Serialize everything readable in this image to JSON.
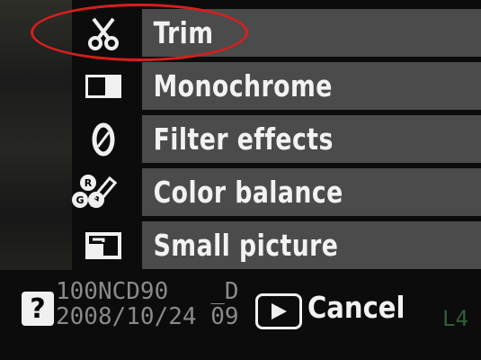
{
  "menu": {
    "items": [
      {
        "label": "Trim",
        "icon": "scissors-icon"
      },
      {
        "label": "Monochrome",
        "icon": "monochrome-icon"
      },
      {
        "label": "Filter effects",
        "icon": "filter-lens-icon"
      },
      {
        "label": "Color balance",
        "icon": "color-balance-icon"
      },
      {
        "label": "Small picture",
        "icon": "small-picture-icon"
      }
    ],
    "highlighted_item": "Trim",
    "highlight_color": "#d81e1e"
  },
  "icon_letters": {
    "r": "R",
    "g": "G",
    "b": "B"
  },
  "footer": {
    "help_label": "?",
    "folder": "100NCD90",
    "date": "2008/10/24",
    "trailing_top": "_D",
    "trailing_bottom": "09",
    "cancel_label": "Cancel",
    "corner_text": "L4"
  },
  "colors": {
    "background": "#0c0c0c",
    "row_background": "#4b4b4b",
    "text": "#f2f2f2",
    "info_text": "#8a8a8a"
  }
}
